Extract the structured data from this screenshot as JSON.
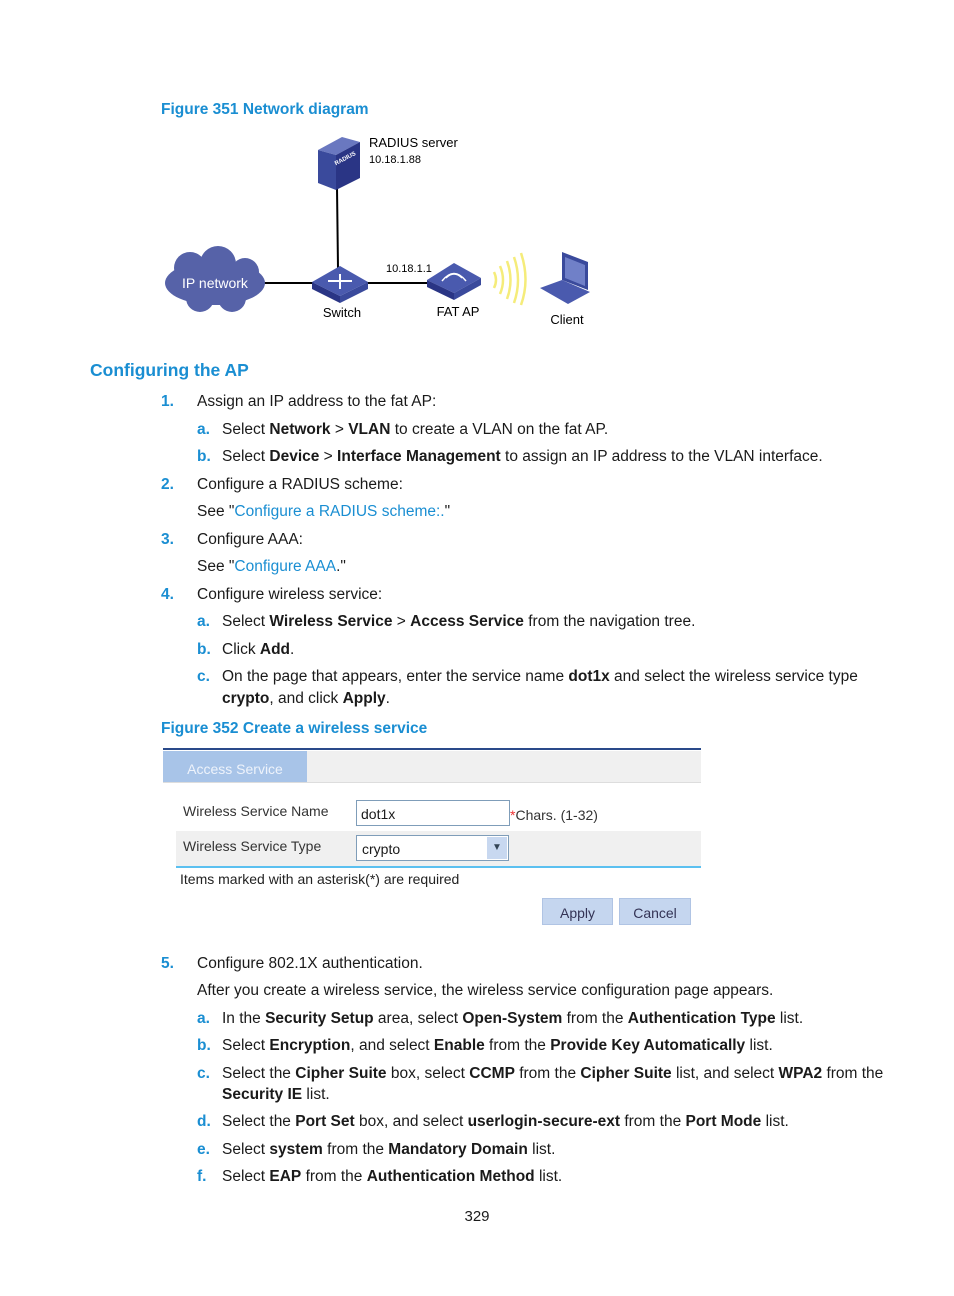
{
  "figure351": {
    "caption": "Figure 351 Network diagram",
    "radius_label": "RADIUS server",
    "radius_ip": "10.18.1.88",
    "radius_logo": "RADIUS",
    "cloud_label": "IP network",
    "switch_label": "Switch",
    "switch_logo": "SWITCH",
    "ap_ip": "10.18.1.1",
    "ap_label": "FAT AP",
    "client_label": "Client",
    "colors": {
      "device": "#3a4a9c",
      "cloud": "#5662a8",
      "wireless": "#f5ec7a"
    }
  },
  "heading": "Configuring the AP",
  "steps_a": [
    {
      "marker": "1.",
      "level": 1,
      "segs": [
        {
          "t": "Assign an IP address to the fat AP:"
        }
      ]
    },
    {
      "marker": "a.",
      "level": 2,
      "segs": [
        {
          "t": "Select "
        },
        {
          "t": "Network",
          "s": "b"
        },
        {
          "t": " > "
        },
        {
          "t": "VLAN",
          "s": "b"
        },
        {
          "t": " to create a VLAN on the fat AP."
        }
      ]
    },
    {
      "marker": "b.",
      "level": 2,
      "segs": [
        {
          "t": "Select "
        },
        {
          "t": "Device",
          "s": "b"
        },
        {
          "t": " > "
        },
        {
          "t": "Interface Management",
          "s": "b"
        },
        {
          "t": " to assign an IP address to the VLAN interface."
        }
      ]
    },
    {
      "marker": "2.",
      "level": 1,
      "segs": [
        {
          "t": "Configure a RADIUS scheme:"
        }
      ]
    },
    {
      "marker": "",
      "level": 1,
      "segs": [
        {
          "t": "See \""
        },
        {
          "t": "Configure a RADIUS scheme:.",
          "s": "l"
        },
        {
          "t": "\""
        }
      ]
    },
    {
      "marker": "3.",
      "level": 1,
      "segs": [
        {
          "t": "Configure AAA:"
        }
      ]
    },
    {
      "marker": "",
      "level": 1,
      "segs": [
        {
          "t": "See \""
        },
        {
          "t": "Configure AAA",
          "s": "l"
        },
        {
          "t": ".\""
        }
      ]
    },
    {
      "marker": "4.",
      "level": 1,
      "segs": [
        {
          "t": "Configure wireless service:"
        }
      ]
    },
    {
      "marker": "a.",
      "level": 2,
      "segs": [
        {
          "t": "Select "
        },
        {
          "t": "Wireless Service",
          "s": "b"
        },
        {
          "t": " > "
        },
        {
          "t": "Access Service",
          "s": "b"
        },
        {
          "t": " from the navigation tree."
        }
      ]
    },
    {
      "marker": "b.",
      "level": 2,
      "segs": [
        {
          "t": "Click "
        },
        {
          "t": "Add",
          "s": "b"
        },
        {
          "t": "."
        }
      ]
    },
    {
      "marker": "c.",
      "level": 2,
      "segs": [
        {
          "t": "On the page that appears, enter the service name "
        },
        {
          "t": "dot1x",
          "s": "b"
        },
        {
          "t": " and select the wireless service type"
        }
      ]
    },
    {
      "marker": "",
      "level": 2,
      "segs": [
        {
          "t": "crypto",
          "s": "b"
        },
        {
          "t": ", and click "
        },
        {
          "t": "Apply",
          "s": "b"
        },
        {
          "t": "."
        }
      ]
    }
  ],
  "figure352": {
    "caption": "Figure 352 Create a wireless service",
    "tab": "Access Service",
    "name_label": "Wireless Service Name",
    "name_value": "dot1x",
    "asterisk": "*",
    "name_hint": "Chars. (1-32)",
    "type_label": "Wireless Service Type",
    "type_value": "crypto",
    "note": "Items marked with an asterisk(*) are required",
    "apply": "Apply",
    "cancel": "Cancel"
  },
  "steps_b": [
    {
      "marker": "5.",
      "level": 1,
      "segs": [
        {
          "t": "Configure 802.1X authentication."
        }
      ]
    },
    {
      "marker": "",
      "level": 1,
      "segs": [
        {
          "t": "After you create a wireless service, the wireless service configuration page appears."
        }
      ]
    },
    {
      "marker": "a.",
      "level": 2,
      "segs": [
        {
          "t": "In the "
        },
        {
          "t": "Security Setup",
          "s": "b"
        },
        {
          "t": " area, select "
        },
        {
          "t": "Open-System",
          "s": "b"
        },
        {
          "t": " from the "
        },
        {
          "t": "Authentication Type",
          "s": "b"
        },
        {
          "t": " list."
        }
      ]
    },
    {
      "marker": "b.",
      "level": 2,
      "segs": [
        {
          "t": "Select "
        },
        {
          "t": "Encryption",
          "s": "b"
        },
        {
          "t": ", and select "
        },
        {
          "t": "Enable",
          "s": "b"
        },
        {
          "t": " from the "
        },
        {
          "t": "Provide Key Automatically",
          "s": "b"
        },
        {
          "t": " list."
        }
      ]
    },
    {
      "marker": "c.",
      "level": 2,
      "segs": [
        {
          "t": "Select the "
        },
        {
          "t": "Cipher Suite",
          "s": "b"
        },
        {
          "t": " box, select "
        },
        {
          "t": "CCMP",
          "s": "b"
        },
        {
          "t": " from the "
        },
        {
          "t": "Cipher Suite",
          "s": "b"
        },
        {
          "t": " list, and select "
        },
        {
          "t": "WPA2",
          "s": "b"
        },
        {
          "t": " from the"
        }
      ]
    },
    {
      "marker": "",
      "level": 2,
      "segs": [
        {
          "t": "Security IE",
          "s": "b"
        },
        {
          "t": " list."
        }
      ]
    },
    {
      "marker": "d.",
      "level": 2,
      "segs": [
        {
          "t": "Select the "
        },
        {
          "t": "Port Set",
          "s": "b"
        },
        {
          "t": " box, and select "
        },
        {
          "t": "userlogin-secure-ext",
          "s": "b"
        },
        {
          "t": " from the "
        },
        {
          "t": "Port Mode",
          "s": "b"
        },
        {
          "t": " list."
        }
      ]
    },
    {
      "marker": "e.",
      "level": 2,
      "segs": [
        {
          "t": "Select "
        },
        {
          "t": "system",
          "s": "b"
        },
        {
          "t": " from the "
        },
        {
          "t": "Mandatory Domain",
          "s": "b"
        },
        {
          "t": " list."
        }
      ]
    },
    {
      "marker": "f.",
      "level": 2,
      "segs": [
        {
          "t": "Select "
        },
        {
          "t": "EAP",
          "s": "b"
        },
        {
          "t": " from the "
        },
        {
          "t": "Authentication Method",
          "s": "b"
        },
        {
          "t": " list."
        }
      ]
    }
  ],
  "page_number": "329"
}
